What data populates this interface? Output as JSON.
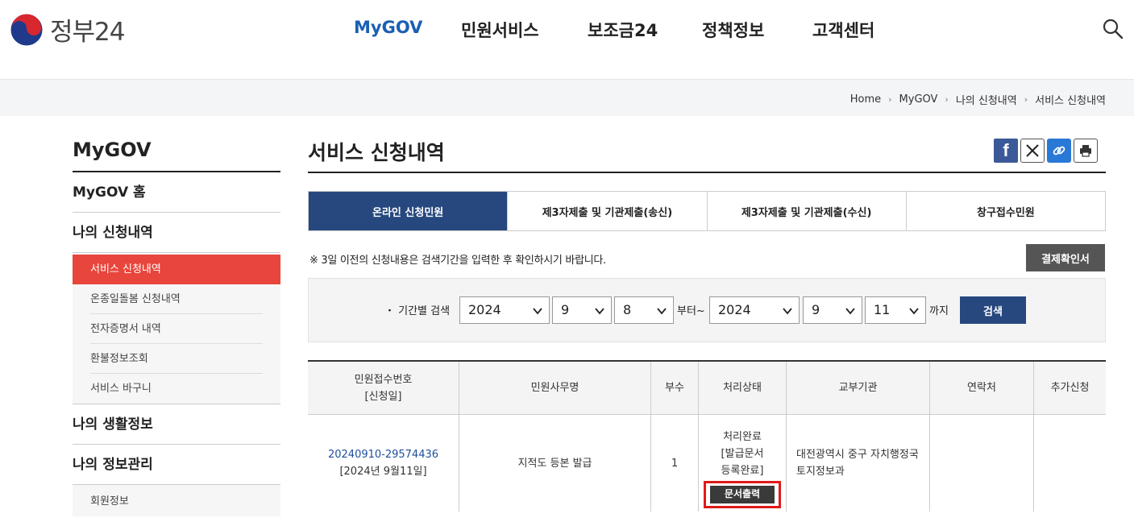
{
  "header": {
    "logo_text": "정부24",
    "nav": [
      {
        "label": "MyGOV",
        "active": true
      },
      {
        "label": "민원서비스",
        "active": false
      },
      {
        "label": "보조금24",
        "active": false
      },
      {
        "label": "정책정보",
        "active": false
      },
      {
        "label": "고객센터",
        "active": false
      }
    ],
    "search_icon": "search-icon"
  },
  "breadcrumb": [
    "Home",
    "MyGOV",
    "나의 신청내역",
    "서비스 신청내역"
  ],
  "sidebar": {
    "title": "MyGOV",
    "items": [
      {
        "label": "MyGOV 홈"
      },
      {
        "label": "나의 신청내역",
        "children": [
          "서비스 신청내역",
          "온종일돌봄 신청내역",
          "전자증명서 내역",
          "환불정보조회",
          "서비스 바구니"
        ]
      },
      {
        "label": "나의 생활정보"
      },
      {
        "label": "나의 정보관리",
        "children": [
          "회원정보"
        ]
      }
    ]
  },
  "main": {
    "title": "서비스 신청내역",
    "share_icons": [
      "facebook-icon",
      "x-icon",
      "link-icon",
      "print-icon"
    ],
    "tabs": [
      "온라인 신청민원",
      "제3자제출 및 기관제출(송신)",
      "제3자제출 및 기관제출(수신)",
      "창구접수민원"
    ],
    "notice": "※ 3일 이전의 신청내용은 검색기간을 입력한 후 확인하시기 바랍니다.",
    "confirm_button": "결제확인서",
    "search": {
      "label": "・ 기간별 검색",
      "from": {
        "year": "2024",
        "month": "9",
        "day": "8"
      },
      "from_suffix": "부터~",
      "to": {
        "year": "2024",
        "month": "9",
        "day": "11"
      },
      "to_suffix": "까지",
      "button": "검색"
    },
    "table": {
      "headers": [
        "민원접수번호",
        "[신청일]",
        "민원사무명",
        "부수",
        "처리상태",
        "교부기관",
        "연락처",
        "추가신청"
      ],
      "row": {
        "receipt_no": "20240910-29574436",
        "date": "[2024년 9월11일]",
        "service": "지적도 등본 발급",
        "copies": "1",
        "status1": "처리완료",
        "status2": "[발급문서",
        "status3": "등록완료]",
        "print_button": "문서출력",
        "agency1": "대전광역시 중구 자치행정국",
        "agency2": "토지정보과",
        "contact": "",
        "extra": ""
      }
    }
  },
  "colors": {
    "primary_nav": "#1a5fb4",
    "tab_active": "#26487e",
    "side_active": "#e8453c",
    "highlight": "#e01a1a"
  }
}
